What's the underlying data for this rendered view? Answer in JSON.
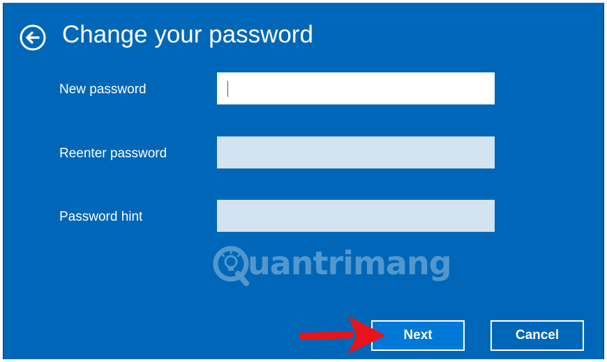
{
  "window": {
    "title": "Change your password",
    "back_icon": "back-arrow-circle-icon"
  },
  "form": {
    "new_password_label": "New password",
    "new_password_value": "",
    "reenter_password_label": "Reenter password",
    "reenter_password_value": "",
    "password_hint_label": "Password hint",
    "password_hint_value": ""
  },
  "watermark": {
    "text": "uantrimang",
    "logo_letter": "Q"
  },
  "buttons": {
    "next_label": "Next",
    "cancel_label": "Cancel"
  },
  "annotation": {
    "arrow_icon": "red-arrow-icon",
    "arrow_color": "#e8141a"
  },
  "colors": {
    "dialog_background": "#0067b8",
    "next_button_background": "#0078d7",
    "disabled_field": "#d4e3f0"
  }
}
